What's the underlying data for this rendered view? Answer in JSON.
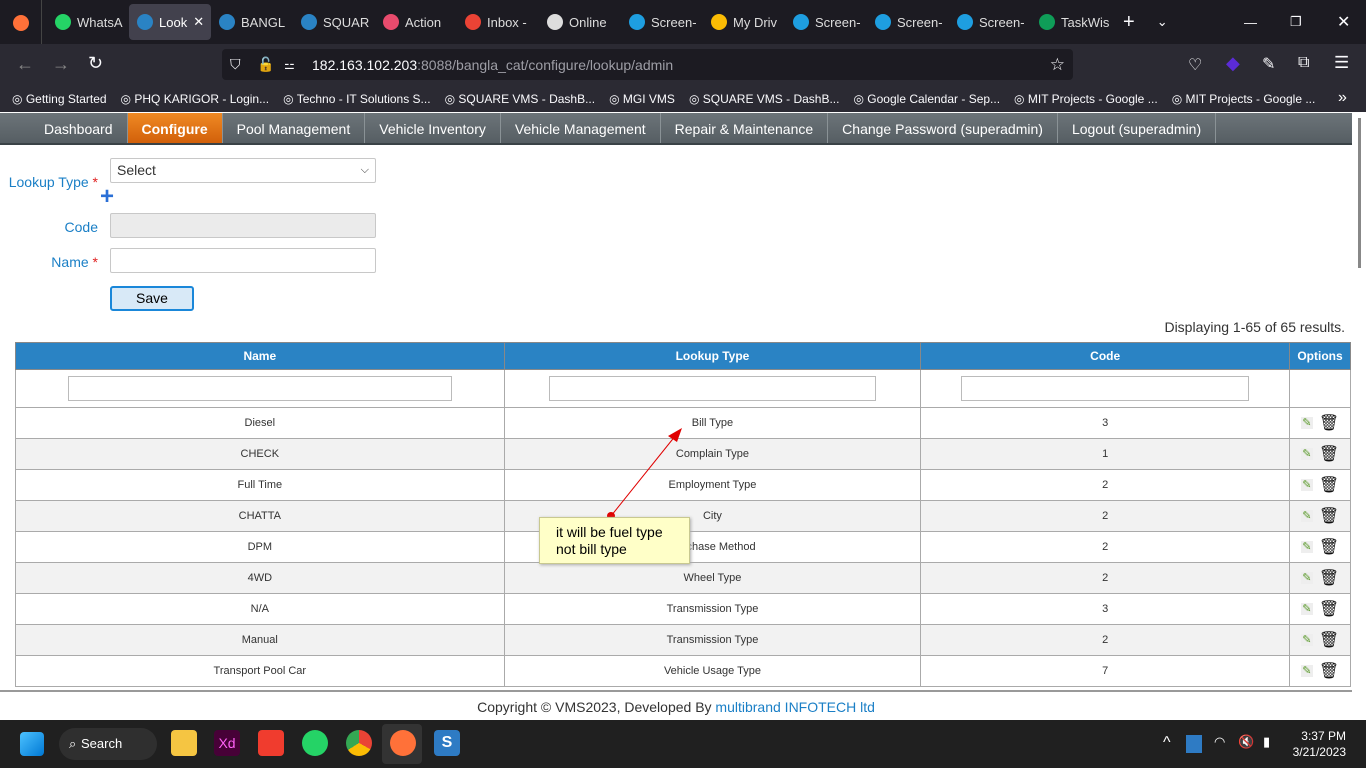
{
  "browser": {
    "tabs": [
      {
        "label": "WhatsA",
        "color": "#25d366"
      },
      {
        "label": "Look",
        "color": "#2a83c4",
        "active": true
      },
      {
        "label": "BANGL",
        "color": "#2a83c4"
      },
      {
        "label": "SQUAR",
        "color": "#2a83c4"
      },
      {
        "label": "Action",
        "color": "#e84b6d"
      },
      {
        "label": "Inbox -",
        "color": "#ea4335"
      },
      {
        "label": "Online",
        "color": "#ddd"
      },
      {
        "label": "Screen-",
        "color": "#1e9ee0"
      },
      {
        "label": "My Driv",
        "color": "#fbbc04"
      },
      {
        "label": "Screen-",
        "color": "#1e9ee0"
      },
      {
        "label": "Screen-",
        "color": "#1e9ee0"
      },
      {
        "label": "Screen-",
        "color": "#1e9ee0"
      },
      {
        "label": "TaskWis",
        "color": "#0f9d58"
      }
    ],
    "url_host": "182.163.102.203",
    "url_rest": ":8088/bangla_cat/configure/lookup/admin",
    "bookmarks": [
      "Getting Started",
      "PHQ KARIGOR - Login...",
      "Techno - IT Solutions S...",
      "SQUARE VMS - DashB...",
      "MGI VMS",
      "SQUARE VMS - DashB...",
      "Google Calendar - Sep...",
      "MIT Projects - Google ...",
      "MIT Projects - Google ..."
    ]
  },
  "nav": [
    "Dashboard",
    "Configure",
    "Pool Management",
    "Vehicle Inventory",
    "Vehicle Management",
    "Repair & Maintenance",
    "Change Password (superadmin)",
    "Logout (superadmin)"
  ],
  "form": {
    "lookup_type_label": "Lookup Type",
    "required": "*",
    "lookup_type_value": "Select",
    "code_label": "Code",
    "name_label": "Name",
    "save": "Save"
  },
  "summary": "Displaying 1-65 of 65 results.",
  "table": {
    "headers": [
      "Name",
      "Lookup Type",
      "Code",
      "Options"
    ],
    "rows": [
      [
        "Diesel",
        "Bill Type",
        "3"
      ],
      [
        "CHECK",
        "Complain Type",
        "1"
      ],
      [
        "Full Time",
        "Employment Type",
        "2"
      ],
      [
        "CHATTA",
        "City",
        "2"
      ],
      [
        "DPM",
        "Purchase Method",
        "2"
      ],
      [
        "4WD",
        "Wheel Type",
        "2"
      ],
      [
        "N/A",
        "Transmission Type",
        "3"
      ],
      [
        "Manual",
        "Transmission Type",
        "2"
      ],
      [
        "Transport Pool Car",
        "Vehicle Usage Type",
        "7"
      ]
    ]
  },
  "annotation": {
    "line1": "it will be fuel type",
    "line2": "not bill type",
    "color": "#e00000"
  },
  "footer": {
    "text": "Copyright © VMS2023, Developed By ",
    "link": "multibrand INFOTECH ltd"
  },
  "taskbar": {
    "search": "Search",
    "time": "3:37 PM",
    "date": "3/21/2023"
  }
}
